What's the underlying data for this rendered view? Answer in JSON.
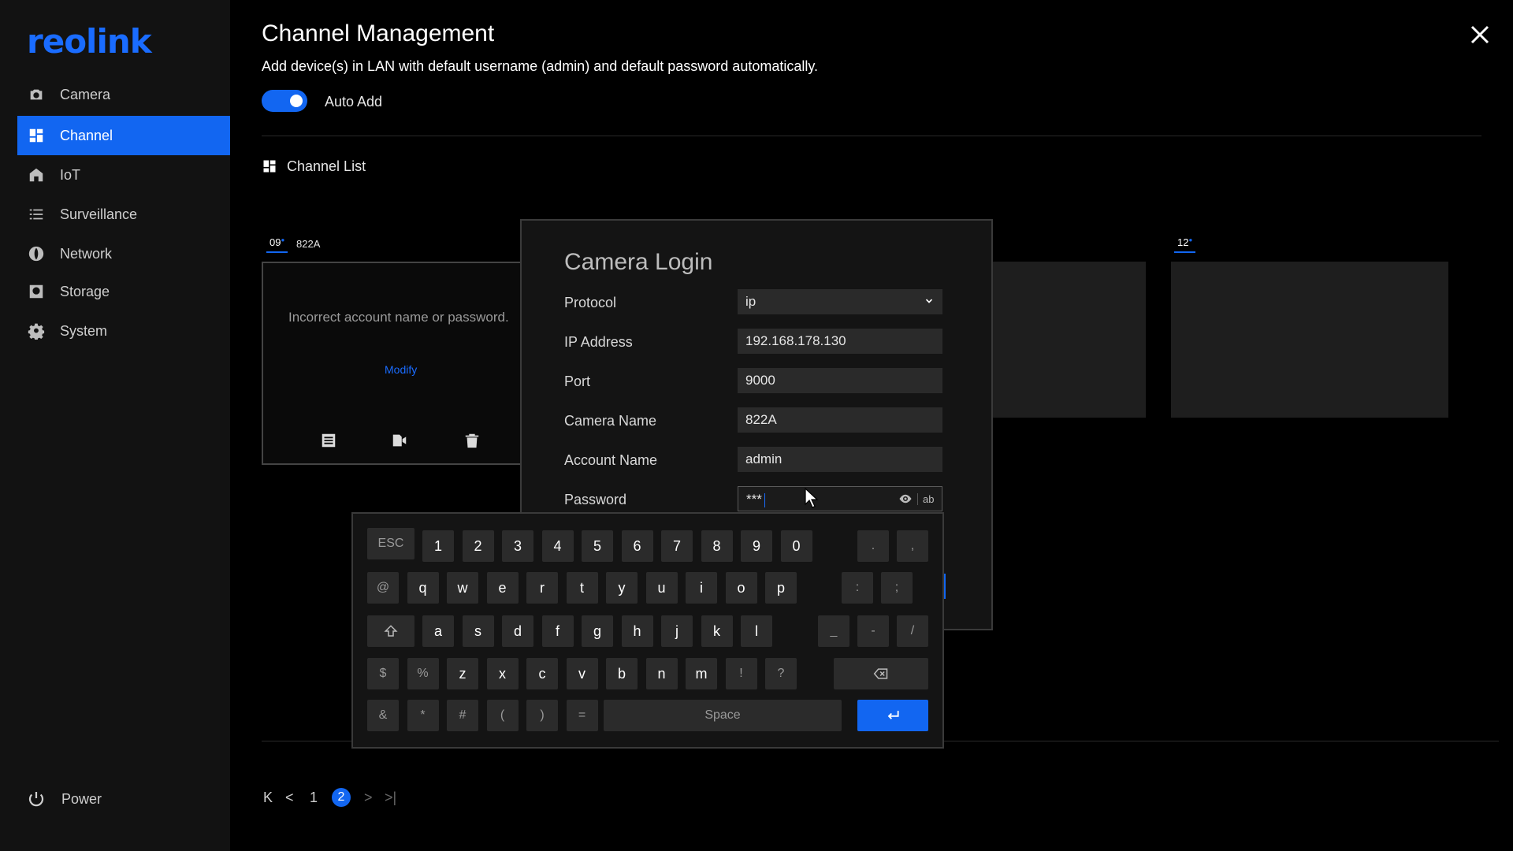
{
  "logo": "reolink",
  "sidebar": {
    "items": [
      {
        "label": "Camera",
        "icon": "camera-icon"
      },
      {
        "label": "Channel",
        "icon": "channel-grid-icon",
        "active": true
      },
      {
        "label": "IoT",
        "icon": "iot-home-icon"
      },
      {
        "label": "Surveillance",
        "icon": "list-icon"
      },
      {
        "label": "Network",
        "icon": "globe-icon"
      },
      {
        "label": "Storage",
        "icon": "storage-icon"
      },
      {
        "label": "System",
        "icon": "gear-icon"
      }
    ],
    "power_label": "Power"
  },
  "header": {
    "title": "Channel Management",
    "description": "Add device(s) in LAN with default username (admin) and default password automatically.",
    "auto_add_label": "Auto Add",
    "auto_add_on": true
  },
  "channel_list": {
    "label": "Channel List",
    "tiles": [
      {
        "number": "09",
        "name": "822A",
        "error": "Incorrect account name or password.",
        "action": "Modify"
      },
      {
        "number": "12",
        "name": ""
      }
    ]
  },
  "dialog": {
    "title": "Camera Login",
    "fields": {
      "protocol": {
        "label": "Protocol",
        "value": "ip"
      },
      "ip": {
        "label": "IP Address",
        "value": "192.168.178.130"
      },
      "port": {
        "label": "Port",
        "value": "9000"
      },
      "camera_name": {
        "label": "Camera Name",
        "value": "822A"
      },
      "account": {
        "label": "Account Name",
        "value": "admin"
      },
      "password": {
        "label": "Password",
        "value": "***",
        "toggle": "ab"
      }
    }
  },
  "keyboard": {
    "esc": "ESC",
    "row1": [
      "1",
      "2",
      "3",
      "4",
      "5",
      "6",
      "7",
      "8",
      "9",
      "0"
    ],
    "row1_extra": [
      ".",
      ","
    ],
    "row2": [
      "@",
      "q",
      "w",
      "e",
      "r",
      "t",
      "y",
      "u",
      "i",
      "o",
      "p"
    ],
    "row2_extra": [
      ":",
      ";"
    ],
    "row3": [
      "a",
      "s",
      "d",
      "f",
      "g",
      "h",
      "j",
      "k",
      "l"
    ],
    "row3_extra": [
      "_",
      "-",
      "/"
    ],
    "row4": [
      "$",
      "%",
      "z",
      "x",
      "c",
      "v",
      "b",
      "n",
      "m",
      "!",
      "?"
    ],
    "row5": [
      "&",
      "*",
      "#",
      "(",
      ")",
      "="
    ],
    "space": "Space"
  },
  "pagination": {
    "page1": "1",
    "current": "2"
  },
  "colors": {
    "accent": "#1266f1",
    "background": "#000000",
    "sidebar": "#121212"
  }
}
